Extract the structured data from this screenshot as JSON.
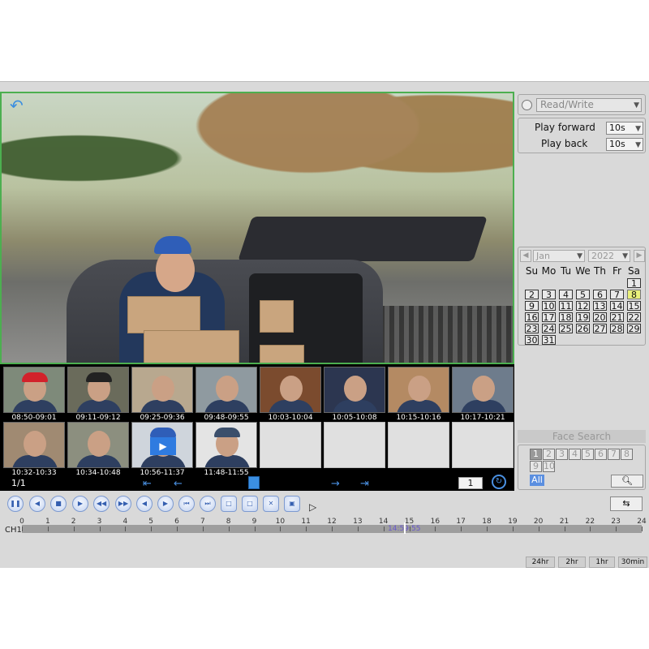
{
  "right_panel": {
    "mode_select": "Read/Write",
    "play_forward_label": "Play forward",
    "play_forward_value": "10s",
    "play_back_label": "Play back",
    "play_back_value": "10s",
    "calendar": {
      "month": "Jan",
      "year": "2022",
      "weekdays": [
        "Su",
        "Mo",
        "Tu",
        "We",
        "Th",
        "Fr",
        "Sa"
      ],
      "selected_day": "8",
      "days": [
        "1",
        "2",
        "3",
        "4",
        "5",
        "6",
        "7",
        "8",
        "9",
        "10",
        "11",
        "12",
        "13",
        "14",
        "15",
        "16",
        "17",
        "18",
        "19",
        "20",
        "21",
        "22",
        "23",
        "24",
        "25",
        "26",
        "27",
        "28",
        "29",
        "30",
        "31"
      ]
    },
    "face_search": {
      "title": "Face Search",
      "numbers": [
        "1",
        "2",
        "3",
        "4",
        "5",
        "6",
        "7",
        "8",
        "9",
        "10"
      ],
      "all_label": "All"
    }
  },
  "thumbnails": {
    "row1": [
      {
        "label": "08:50-09:01",
        "hat": "#d2222b"
      },
      {
        "label": "09:11-09:12",
        "hat": "#222222"
      },
      {
        "label": "09:25-09:36",
        "hat": ""
      },
      {
        "label": "09:48-09:55",
        "hat": ""
      },
      {
        "label": "10:03-10:04",
        "hat": ""
      },
      {
        "label": "10:05-10:08",
        "hat": ""
      },
      {
        "label": "10:15-10:16",
        "hat": ""
      },
      {
        "label": "10:17-10:21",
        "hat": ""
      }
    ],
    "row2": [
      {
        "label": "10:32-10:33",
        "hat": ""
      },
      {
        "label": "10:34-10:48",
        "hat": ""
      },
      {
        "label": "10:56-11:37",
        "hat": "#2f5eb8"
      },
      {
        "label": "11:48-11:55",
        "hat": "#3b4f6b"
      }
    ],
    "pager_text": "1/1",
    "page_input": "1"
  },
  "timeline": {
    "channel": "CH1",
    "ticks": [
      "0",
      "1",
      "2",
      "3",
      "4",
      "5",
      "6",
      "7",
      "8",
      "9",
      "10",
      "11",
      "12",
      "13",
      "14",
      "15",
      "16",
      "17",
      "18",
      "19",
      "20",
      "21",
      "22",
      "23",
      "24"
    ],
    "cursor_time": "14:59:55",
    "zoom_options": [
      "24hr",
      "2hr",
      "1hr",
      "30min"
    ]
  },
  "colors": {
    "accent_blue": "#3b8fe3",
    "video_border": "#4caf50",
    "selected_day": "#e9f07a"
  }
}
